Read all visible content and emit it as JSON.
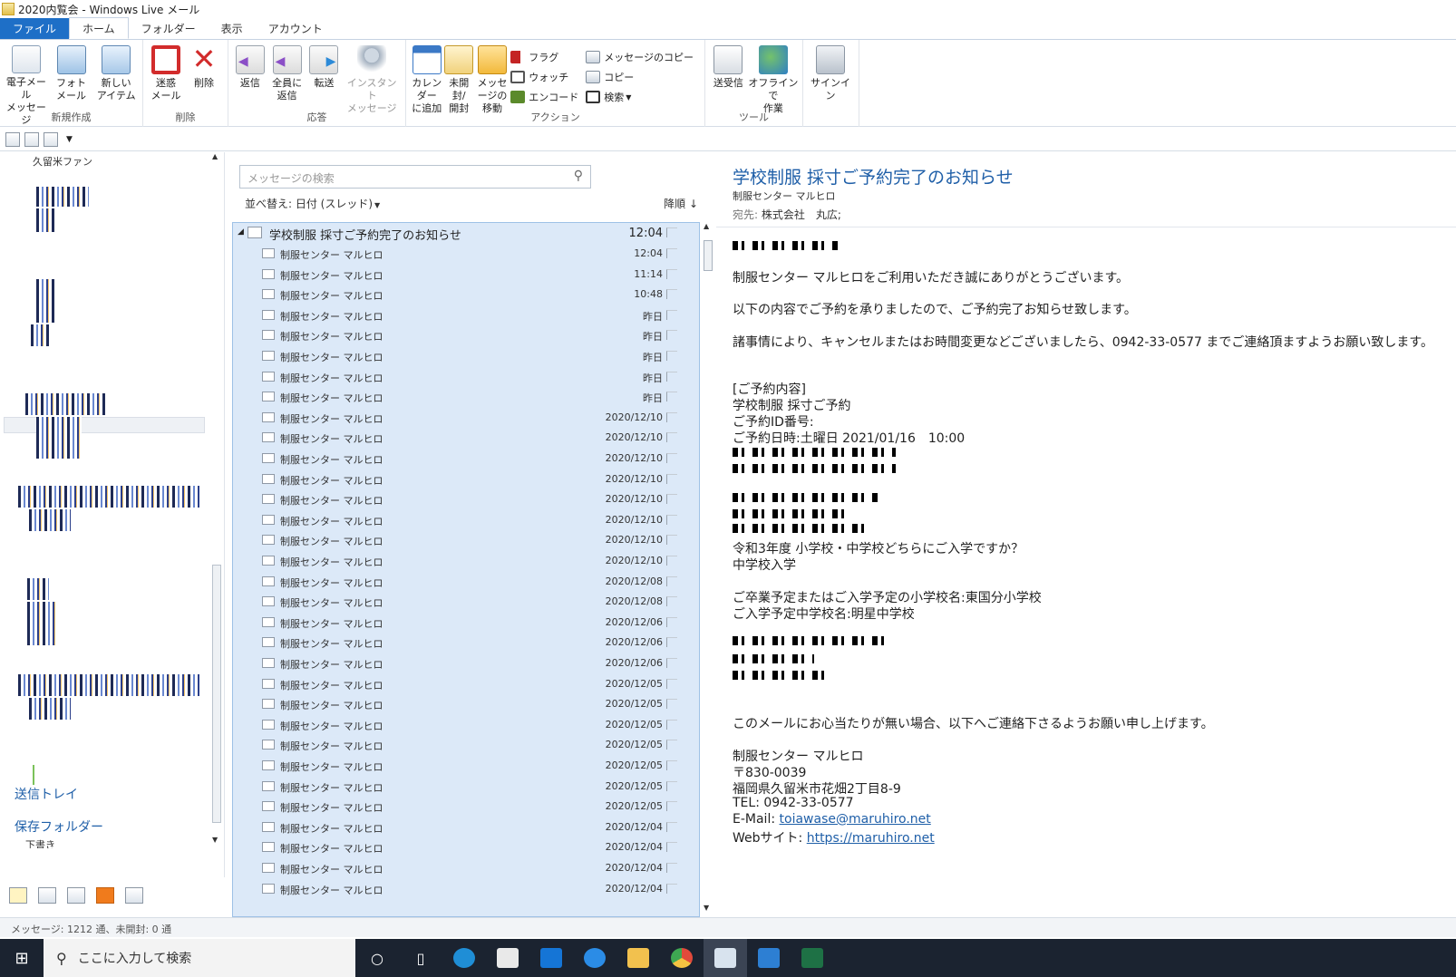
{
  "window": {
    "title": "2020内覧会 - Windows Live メール"
  },
  "tabs": [
    "ファイル",
    "ホーム",
    "フォルダー",
    "表示",
    "アカウント"
  ],
  "ribbon": {
    "new": {
      "label": "新規作成",
      "email": "電子メール\nメッセージ",
      "photo": "フォト\nメール",
      "newitem": "新しい\nアイテム"
    },
    "delete": {
      "label": "削除",
      "junk": "迷惑\nメール",
      "delete": "削除"
    },
    "respond": {
      "label": "応答",
      "reply": "返信",
      "replyall": "全員に\n返信",
      "forward": "転送",
      "im": "インスタント\nメッセージ"
    },
    "actions": {
      "label": "アクション",
      "calendar": "カレンダー\nに追加",
      "unread": "未開封/\n開封",
      "move": "メッセージの\n移動",
      "flag": "フラグ",
      "watch": "ウォッチ",
      "encode": "エンコード",
      "copymsg": "メッセージのコピー",
      "copy": "コピー",
      "search": "検索"
    },
    "tools": {
      "label": "ツール",
      "sendrecv": "送受信",
      "offline": "オフラインで\n作業"
    },
    "signin": "サインイン"
  },
  "folders": {
    "top_partial": "久留米ファン",
    "outbox": "送信トレイ",
    "saved": "保存フォルダー",
    "drafts_partial": "下書き"
  },
  "list": {
    "search_placeholder": "メッセージの検索",
    "sort": "並べ替え: 日付 (スレッド)",
    "order": "降順 ↓",
    "thread_subject": "学校制服 採寸ご予約完了のお知らせ",
    "thread_time": "12:04",
    "sender": "制服センター マルヒロ",
    "dates": [
      "12:04",
      "11:14",
      "10:48",
      "昨日",
      "昨日",
      "昨日",
      "昨日",
      "昨日",
      "2020/12/10",
      "2020/12/10",
      "2020/12/10",
      "2020/12/10",
      "2020/12/10",
      "2020/12/10",
      "2020/12/10",
      "2020/12/10",
      "2020/12/08",
      "2020/12/08",
      "2020/12/06",
      "2020/12/06",
      "2020/12/06",
      "2020/12/05",
      "2020/12/05",
      "2020/12/05",
      "2020/12/05",
      "2020/12/05",
      "2020/12/05",
      "2020/12/05",
      "2020/12/04",
      "2020/12/04",
      "2020/12/04",
      "2020/12/04"
    ]
  },
  "reader": {
    "subject": "学校制服 採寸ご予約完了のお知らせ",
    "from": "制服センター マルヒロ",
    "to_label": "宛先:",
    "to": "株式会社　丸広;",
    "body": {
      "l1": "制服センター マルヒロをご利用いただき誠にありがとうございます。",
      "l2": "以下の内容でご予約を承りましたので、ご予約完了お知らせ致します。",
      "l3": "諸事情により、キャンセルまたはお時間変更などございましたら、0942-33-0577 までご連絡頂ますようお願い致します。",
      "l4": "[ご予約内容]",
      "l5": "学校制服 採寸ご予約",
      "l6": "ご予約ID番号:",
      "l7": "ご予約日時:土曜日 2021/01/16　10:00",
      "l8": "令和3年度 小学校・中学校どちらにご入学ですか？",
      "l9": "中学校入学",
      "l10": "ご卒業予定またはご入学予定の小学校名:東国分小学校",
      "l11": "ご入学予定中学校名:明星中学校",
      "l12": "このメールにお心当たりが無い場合、以下へご連絡下さるようお願い申し上げます。",
      "l13": "制服センター マルヒロ",
      "l14": "〒830-0039",
      "l15": "福岡県久留米市花畑2丁目8-9",
      "l16": "TEL: 0942-33-0577",
      "email_label": "E-Mail: ",
      "email": "toiawase@maruhiro.net",
      "web_label": "Webサイト: ",
      "web": "https://maruhiro.net"
    }
  },
  "status": "メッセージ: 1212 通、未開封: 0 通",
  "taskbar": {
    "search_placeholder": "ここに入力して検索"
  }
}
